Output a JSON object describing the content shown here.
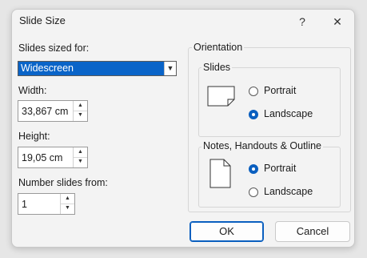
{
  "window": {
    "title": "Slide Size",
    "help_glyph": "?",
    "close_glyph": "✕"
  },
  "size": {
    "sized_for_label": "Slides sized for:",
    "sized_for_value": "Widescreen",
    "width_label": "Width:",
    "width_value": "33,867 cm",
    "height_label": "Height:",
    "height_value": "19,05 cm",
    "number_label": "Number slides from:",
    "number_value": "1"
  },
  "orientation": {
    "title": "Orientation",
    "slides": {
      "title": "Slides",
      "portrait_label": "Portrait",
      "landscape_label": "Landscape",
      "selected": "landscape"
    },
    "notes": {
      "title": "Notes, Handouts & Outline",
      "portrait_label": "Portrait",
      "landscape_label": "Landscape",
      "selected": "portrait"
    }
  },
  "buttons": {
    "ok": "OK",
    "cancel": "Cancel"
  },
  "colors": {
    "accent": "#0a5fbf",
    "selection": "#0a64c8"
  },
  "icons": [
    "help-icon",
    "close-icon",
    "chevron-down-icon",
    "spin-up-icon",
    "spin-down-icon",
    "landscape-page-icon",
    "portrait-page-icon"
  ]
}
